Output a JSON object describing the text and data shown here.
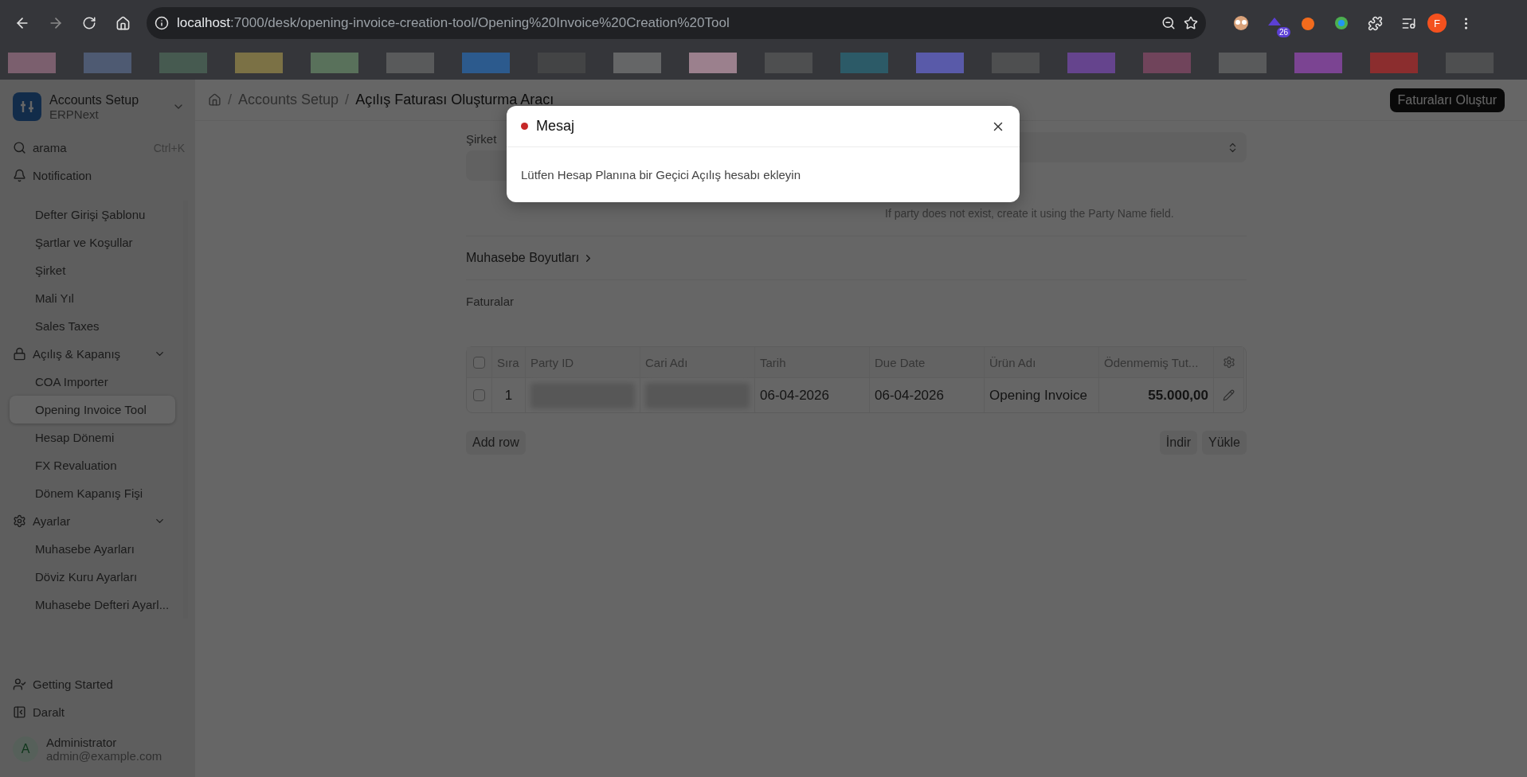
{
  "browser": {
    "url_host": "localhost",
    "url_path": ":7000/desk/opening-invoice-creation-tool/Opening%20Invoice%20Creation%20Tool",
    "extension_badge": "26",
    "profile_initial": "F"
  },
  "sidebar": {
    "app_title": "Accounts Setup",
    "app_subtitle": "ERPNext",
    "search": {
      "placeholder": "arama",
      "shortcut": "Ctrl+K"
    },
    "notification": "Notification",
    "items": [
      {
        "kind": "link",
        "label": "Defter Girişi Şablonu",
        "selected": false
      },
      {
        "kind": "link",
        "label": "Şartlar ve Koşullar",
        "selected": false
      },
      {
        "kind": "link",
        "label": "Şirket",
        "selected": false
      },
      {
        "kind": "link",
        "label": "Mali Yıl",
        "selected": false
      },
      {
        "kind": "link",
        "label": "Sales Taxes",
        "selected": false
      },
      {
        "kind": "group",
        "label": "Açılış & Kapanış",
        "expanded": true
      },
      {
        "kind": "link",
        "label": "COA Importer",
        "selected": false
      },
      {
        "kind": "link",
        "label": "Opening Invoice Tool",
        "selected": true
      },
      {
        "kind": "link",
        "label": "Hesap Dönemi",
        "selected": false
      },
      {
        "kind": "link",
        "label": "FX Revaluation",
        "selected": false
      },
      {
        "kind": "link",
        "label": "Dönem Kapanış Fişi",
        "selected": false
      },
      {
        "kind": "group",
        "label": "Ayarlar",
        "expanded": true
      },
      {
        "kind": "link",
        "label": "Muhasebe Ayarları",
        "selected": false
      },
      {
        "kind": "link",
        "label": "Döviz Kuru Ayarları",
        "selected": false
      },
      {
        "kind": "link",
        "label": "Muhasebe Defteri Ayarl...",
        "selected": false
      }
    ],
    "footer": [
      {
        "label": "Getting Started"
      },
      {
        "label": "Daralt"
      }
    ],
    "user": {
      "initial": "A",
      "name": "Administrator",
      "email": "admin@example.com"
    }
  },
  "breadcrumb": [
    {
      "separator": "/",
      "label": "Accounts Setup"
    },
    {
      "separator": "/",
      "label": "Açılış Faturası Oluşturma Aracı"
    }
  ],
  "primary_button": "Faturaları Oluştur",
  "form": {
    "company_label": "Şirket",
    "party_hint": "If party does not exist, create it using the Party Name field.",
    "section": "Muhasebe Boyutları",
    "table_label": "Faturalar"
  },
  "table": {
    "all_checked": false,
    "columns": [
      "Sıra",
      "Party ID",
      "Cari Adı",
      "Tarih",
      "Due Date",
      "Ürün Adı",
      "Ödenmemiş Tut..."
    ],
    "rows": [
      {
        "checked": false,
        "cells": [
          {
            "text": "1"
          },
          {
            "redacted": true
          },
          {
            "redacted": true
          },
          {
            "text": "06-04-2026"
          },
          {
            "text": "06-04-2026"
          },
          {
            "text": "Opening Invoice"
          },
          {
            "text": "55.000,00"
          }
        ]
      }
    ],
    "add_row": "Add row",
    "buttons": [
      "İndir",
      "Yükle"
    ]
  },
  "modal": {
    "title": "Mesaj",
    "message": "Lütfen Hesap Planına bir Geçici Açılış hesabı ekleyin"
  }
}
